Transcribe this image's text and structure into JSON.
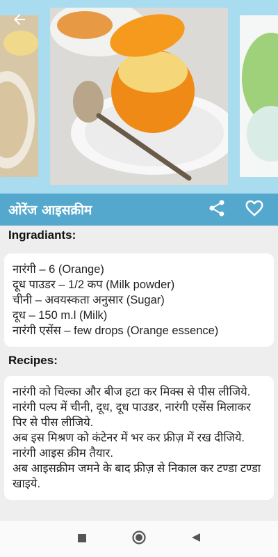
{
  "header": {
    "title": "ओरेंज आइसक्रीम"
  },
  "sections": {
    "ingredients_heading": "Ingradiants:",
    "ingredients": [
      "नारंगी – 6 (Orange)",
      "दूध पाउडर – 1/2 कप (Milk powder)",
      "चीनी – अवयस्कता अनुसार (Sugar)",
      "दूध – 150 m.l (Milk)",
      "नारंगी एसेंस – few drops (Orange essence)"
    ],
    "recipes_heading": "Recipes:",
    "recipe_lines": [
      "नारंगी को चिल्का और बीज हटा कर मिक्स से पीस लीजिये.",
      "नारंगी पल्प में चीनी, दूध, दूध पाउडर, नारंगी एसेंस मिलाकर पिर से पीस लीजिये.",
      "अब इस मिश्रण को कंटेनर में भर कर फ्रीज़ में रख दीजिये. नारंगी आइस क्रीम तैयार.",
      "अब आइसक्रीम जमने के बाद फ्रीज़ से निकाल कर टण्डा टण्डा खाइये."
    ]
  },
  "colors": {
    "title_bar": "#55a8cd",
    "gallery_bg": "#a9dcef"
  }
}
